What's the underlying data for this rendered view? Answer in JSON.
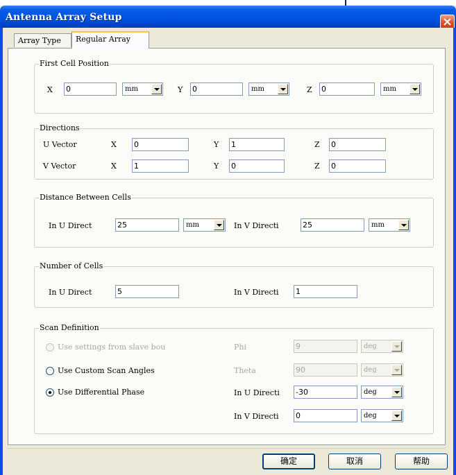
{
  "window": {
    "title": "Antenna Array Setup"
  },
  "tabs": [
    {
      "label": "Array Type"
    },
    {
      "label": "Regular Array"
    }
  ],
  "first_cell_position": {
    "legend": "First Cell Position",
    "x": {
      "label": "X",
      "value": "0",
      "unit": "mm"
    },
    "y": {
      "label": "Y",
      "value": "0",
      "unit": "mm"
    },
    "z": {
      "label": "Z",
      "value": "0",
      "unit": "mm"
    }
  },
  "directions": {
    "legend": "Directions",
    "u_vector": {
      "label": "U Vector",
      "x_label": "X",
      "x": "0",
      "y_label": "Y",
      "y": "1",
      "z_label": "Z",
      "z": "0"
    },
    "v_vector": {
      "label": "V Vector",
      "x_label": "X",
      "x": "1",
      "y_label": "Y",
      "y": "0",
      "z_label": "Z",
      "z": "0"
    }
  },
  "distance_between_cells": {
    "legend": "Distance Between Cells",
    "u_label": "In U Direct",
    "u_value": "25",
    "u_unit": "mm",
    "v_label": "In V Directi",
    "v_value": "25",
    "v_unit": "mm"
  },
  "number_of_cells": {
    "legend": "Number of Cells",
    "u_label": "In U Direct",
    "u_value": "5",
    "v_label": "In V Directi",
    "v_value": "1"
  },
  "scan_definition": {
    "legend": "Scan Definition",
    "options": [
      {
        "label": "Use settings from slave bou",
        "checked": false,
        "enabled": false
      },
      {
        "label": "Use Custom Scan Angles",
        "checked": false,
        "enabled": true
      },
      {
        "label": "Use Differential Phase",
        "checked": true,
        "enabled": true
      }
    ],
    "phi": {
      "label": "Phi",
      "value": "9",
      "unit": "deg"
    },
    "theta": {
      "label": "Theta",
      "value": "90",
      "unit": "deg"
    },
    "u_phase": {
      "label": "In U Directi",
      "value": "-30",
      "unit": "deg"
    },
    "v_phase": {
      "label": "In V Directi",
      "value": "0",
      "unit": "deg"
    }
  },
  "buttons": {
    "ok": "确定",
    "cancel": "取消",
    "help": "帮助"
  },
  "colors": {
    "title_bar": "#0052e0",
    "close_button": "#e05530",
    "dialog_bg": "#ece9d8",
    "tab_highlight": "#ffc83c"
  }
}
